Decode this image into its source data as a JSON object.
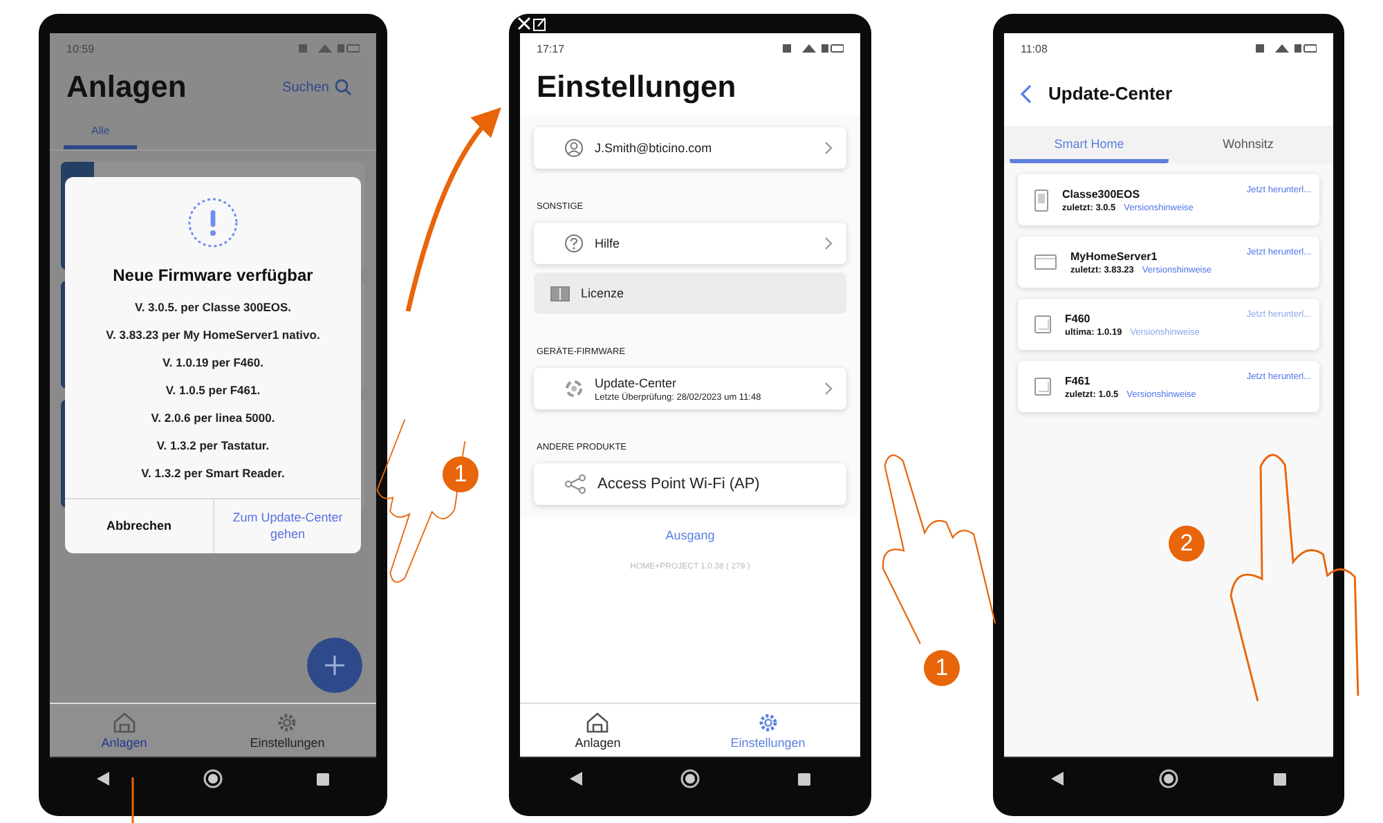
{
  "phones": [
    {
      "kind": "plants",
      "status_time": "10:59",
      "title": "Anlagen",
      "search_label": "Suchen",
      "tabs": [
        {
          "label": "Alle",
          "selected": true
        }
      ],
      "dialog": {
        "title": "Neue Firmware verfügbar",
        "lines": [
          "V. 3.0.5. per Classe 300EOS.",
          "V. 3.83.23 per My HomeServer1 nativo.",
          "V. 1.0.19 per F460.",
          "V. 1.0.5 per F461.",
          "V. 2.0.6 per linea 5000.",
          "V. 1.3.2 per Tastatur.",
          "V. 1.3.2 per Smart Reader."
        ],
        "buttons": [
          {
            "kind": "cancel",
            "label": "Abbrechen"
          },
          {
            "kind": "confirm",
            "label": "Zum Update-Center gehen"
          }
        ]
      },
      "nav": [
        {
          "kind": "home",
          "label": "Anlagen",
          "selected": true
        },
        {
          "kind": "settings",
          "label": "Einstellungen",
          "selected": false
        }
      ]
    },
    {
      "kind": "settings",
      "status_time": "17:17",
      "title": "Einstellungen",
      "sections": [
        {
          "items": [
            {
              "kind": "account",
              "label": "J.Smith@bticino.com",
              "chevron": true,
              "highlighted": false
            }
          ]
        },
        {
          "heading": "SONSTIGE",
          "items": [
            {
              "kind": "help",
              "label": "Hilfe",
              "chevron": true,
              "highlighted": false
            },
            {
              "kind": "license",
              "label": "Licenze",
              "chevron": false,
              "highlighted": true
            }
          ]
        },
        {
          "heading": "GERÄTE-FIRMWARE",
          "items": [
            {
              "kind": "update",
              "label": "Update-Center",
              "subtitle": "Letzte Überprüfung: 28/02/2023 um 11:48",
              "chevron": true,
              "highlighted": false
            }
          ]
        },
        {
          "heading": "ANDERE PRODUKTE",
          "items": [
            {
              "kind": "network",
              "label": "Access Point Wi-Fi (AP)",
              "chevron": false,
              "highlighted": false
            }
          ]
        }
      ],
      "logout": "Ausgang",
      "version": "HOME+PROJECT 1.0.38 ( 279 )",
      "nav": [
        {
          "kind": "home",
          "label": "Anlagen",
          "selected": false
        },
        {
          "kind": "settings",
          "label": "Einstellungen",
          "selected": true
        }
      ]
    },
    {
      "kind": "update_center",
      "status_time": "11:08",
      "title": "Update-Center",
      "tabs": [
        {
          "label": "Smart Home",
          "selected": true
        },
        {
          "label": "Wohnsitz",
          "selected": false
        }
      ],
      "devices": [
        {
          "kind": "panel",
          "name": "Classe300EOS",
          "version": "zuletzt: 3.0.5",
          "notes": "Versionshinweise",
          "action": "Jetzt herunterl...",
          "disabled": false
        },
        {
          "kind": "server",
          "name": "MyHomeServer1",
          "version": "zuletzt: 3.83.23",
          "notes": "Versionshinweise",
          "action": "Jetzt herunterl...",
          "disabled": false
        },
        {
          "kind": "reader",
          "name": "F460",
          "version": "ultima: 1.0.19",
          "notes": "Versionshinweise",
          "action": "Jetzt herunterl...",
          "disabled": true
        },
        {
          "kind": "reader",
          "name": "F461",
          "version": "zuletzt: 1.0.5",
          "notes": "Versionshinweise",
          "action": "Jetzt herunterl...",
          "disabled": false
        }
      ]
    }
  ],
  "callouts": [
    {
      "label": "1"
    },
    {
      "label": "1"
    },
    {
      "label": "2"
    }
  ]
}
